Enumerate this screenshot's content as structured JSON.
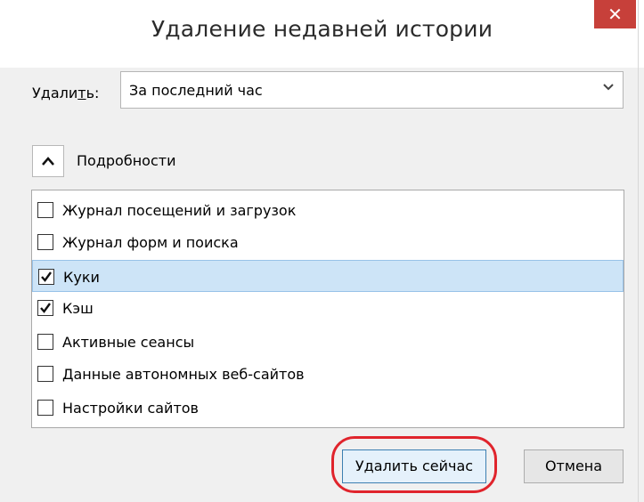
{
  "dialog": {
    "title": "Удаление недавней истории",
    "close_icon": "close-icon"
  },
  "range": {
    "label_pre": "Удали",
    "label_u": "т",
    "label_post": "ь:",
    "selected": "За последний час"
  },
  "details": {
    "label": "Подробности",
    "expanded": true
  },
  "items": [
    {
      "label": "Журнал посещений и загрузок",
      "checked": false,
      "selected": false
    },
    {
      "label": "Журнал форм и поиска",
      "checked": false,
      "selected": false
    },
    {
      "label": "Куки",
      "checked": true,
      "selected": true
    },
    {
      "label": "Кэш",
      "checked": true,
      "selected": false
    },
    {
      "label": "Активные сеансы",
      "checked": false,
      "selected": false
    },
    {
      "label": "Данные автономных веб-сайтов",
      "checked": false,
      "selected": false
    },
    {
      "label": "Настройки сайтов",
      "checked": false,
      "selected": false
    }
  ],
  "buttons": {
    "clear_now": "Удалить сейчас",
    "cancel": "Отмена"
  },
  "colors": {
    "close_bg": "#c7403a",
    "selection_bg": "#cde4f7",
    "annotation_red": "#e0242c"
  }
}
